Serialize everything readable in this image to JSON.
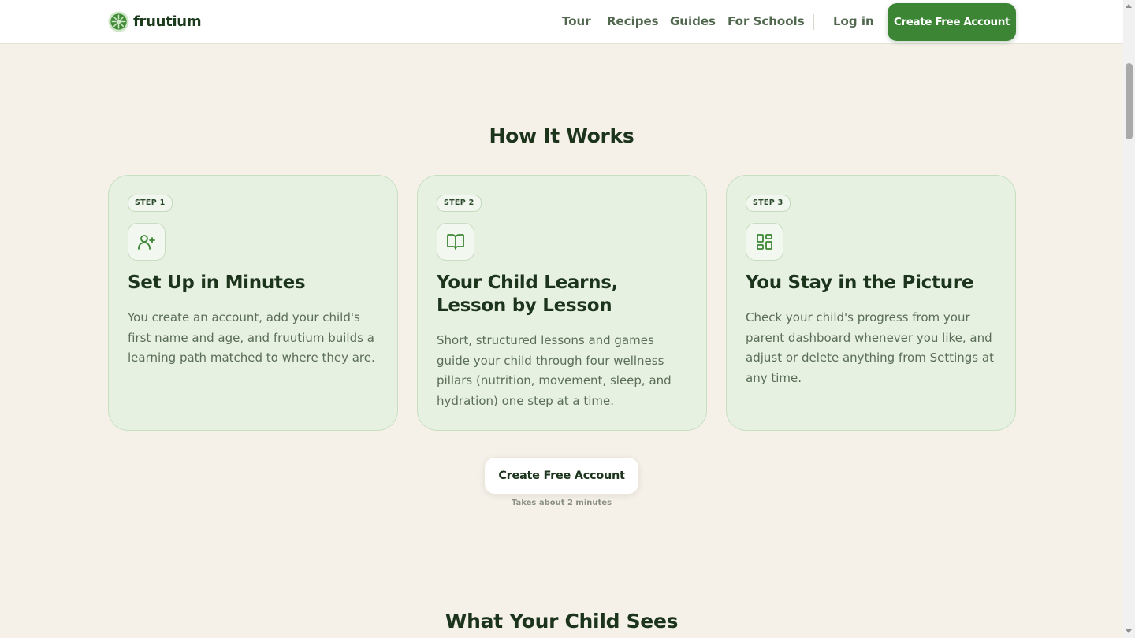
{
  "brand": {
    "name": "fruutium",
    "accent": "#3b8534"
  },
  "nav": {
    "links": [
      "Tour",
      "Recipes",
      "Guides",
      "For Schools"
    ],
    "login": "Log in",
    "cta": "Create Free Account"
  },
  "how_it_works": {
    "title": "How It Works",
    "steps": [
      {
        "badge": "STEP 1",
        "icon": "user-plus-icon",
        "title": "Set Up in Minutes",
        "text": "You create an account, add your child's first name and age, and fruutium builds a learning path matched to where they are."
      },
      {
        "badge": "STEP 2",
        "icon": "book-open-icon",
        "title": "Your Child Learns, Lesson by Lesson",
        "text": "Short, structured lessons and games guide your child through four wellness pillars (nutrition, movement, sleep, and hydration) one step at a time."
      },
      {
        "badge": "STEP 3",
        "icon": "dashboard-icon",
        "title": "You Stay in the Picture",
        "text": "Check your child's progress from your parent dashboard whenever you like, and adjust or delete anything from Settings at any time."
      }
    ],
    "cta": "Create Free Account",
    "cta_note": "Takes about 2 minutes"
  },
  "next_section": {
    "title": "What Your Child Sees"
  }
}
